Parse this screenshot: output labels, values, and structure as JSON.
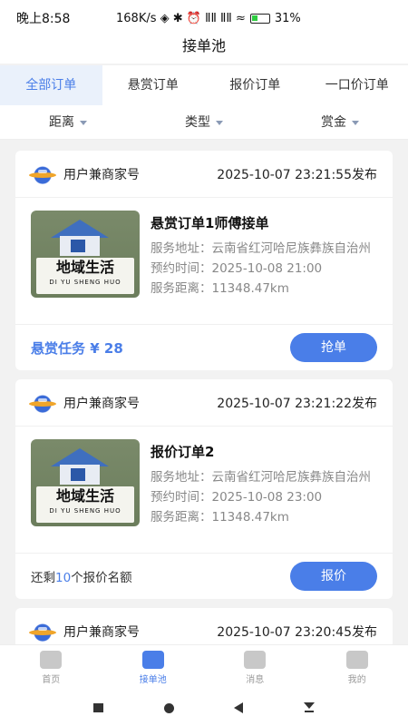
{
  "status": {
    "time": "晚上8:58",
    "indicators": "168K/s ◈ ✱ ⏰ ⅡⅡ ⅡⅡ ≈",
    "battery": "31%"
  },
  "title": "接单池",
  "tabs": [
    {
      "label": "全部订单",
      "active": true
    },
    {
      "label": "悬赏订单",
      "active": false
    },
    {
      "label": "报价订单",
      "active": false
    },
    {
      "label": "一口价订单",
      "active": false
    }
  ],
  "filters": [
    {
      "label": "距离"
    },
    {
      "label": "类型"
    },
    {
      "label": "赏金"
    }
  ],
  "orders": [
    {
      "merchant": "用户兼商家号",
      "posted": "2025-10-07 23:21:55发布",
      "thumb_cn": "地域生活",
      "thumb_en": "DI YU SHENG HUO",
      "title": "悬赏订单1师傅接单",
      "address": "服务地址：云南省红河哈尼族彝族自治州",
      "appointment": "预约时间：2025-10-08 21:00",
      "distance": "服务距离：11348.47km",
      "reward": "悬赏任务 ¥ 28",
      "action": "抢单"
    },
    {
      "merchant": "用户兼商家号",
      "posted": "2025-10-07 23:21:22发布",
      "thumb_cn": "地域生活",
      "thumb_en": "DI YU SHENG HUO",
      "title": "报价订单2",
      "address": "服务地址：云南省红河哈尼族彝族自治州",
      "appointment": "预约时间：2025-10-08 23:00",
      "distance": "服务距离：11348.47km",
      "quota_prefix": "还剩",
      "quota_num": "10",
      "quota_suffix": "个报价名额",
      "action": "报价"
    },
    {
      "merchant": "用户兼商家号",
      "posted": "2025-10-07 23:20:45发布"
    }
  ],
  "tabbar": [
    {
      "label": "首页",
      "icon": "shop-icon",
      "active": false
    },
    {
      "label": "接单池",
      "icon": "order-check-icon",
      "active": true
    },
    {
      "label": "消息",
      "icon": "message-icon",
      "active": false
    },
    {
      "label": "我的",
      "icon": "user-icon",
      "active": false
    }
  ]
}
